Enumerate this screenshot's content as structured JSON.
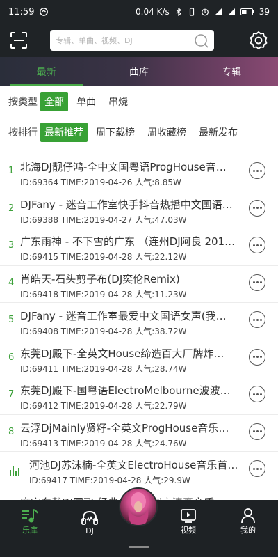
{
  "status_bar": {
    "time": "11:59",
    "speed": "0.04 K/s",
    "battery": "39"
  },
  "header": {
    "search_placeholder": "专辑、单曲、视频、DJ",
    "icons": [
      "scan-icon",
      "search-icon",
      "settings-icon"
    ]
  },
  "tabs": [
    "最新",
    "曲库",
    "专辑"
  ],
  "filters": {
    "type_label": "按类型",
    "type_options": [
      "全部",
      "单曲",
      "串烧"
    ],
    "sort_label": "按排行",
    "sort_options": [
      "最新推荐",
      "周下载榜",
      "周收藏榜",
      "最新发布"
    ]
  },
  "songs": [
    {
      "index": "1",
      "title": "北海DJ靓仔鸿-全中文国粤语ProgHouse音…",
      "meta": "ID:69364  TIME:2019-04-26  人气:8.85W"
    },
    {
      "index": "2",
      "title": "DJFany - 迷音工作室快手抖音热播中文国语…",
      "meta": "ID:69388  TIME:2019-04-27  人气:47.03W"
    },
    {
      "index": "3",
      "title": "广东雨神 - 不下雪的广东 （连州DJ阿良 201…",
      "meta": "ID:69415  TIME:2019-04-28  人气:22.12W"
    },
    {
      "index": "4",
      "title": "肖皓天-石头剪子布(DJ奕伦Remix)",
      "meta": "ID:69418  TIME:2019-04-28  人气:11.23W"
    },
    {
      "index": "5",
      "title": "DJFany - 迷音工作室最爱中文国语女声(我…",
      "meta": "ID:69408  TIME:2019-04-28  人气:38.72W"
    },
    {
      "index": "6",
      "title": "东莞DJ殿下-全英文House缔造百大厂牌炸…",
      "meta": "ID:69411  TIME:2019-04-28  人气:28.74W"
    },
    {
      "index": "7",
      "title": "东莞DJ殿下-国粤语ElectroMelbourne波波…",
      "meta": "ID:69412  TIME:2019-04-28  人气:22.79W"
    },
    {
      "index": "8",
      "title": "云浮DjMainly贤籽-全英文ProgHouse音乐缥…",
      "meta": "ID:69413  TIME:2019-04-28  人气:24.76W"
    },
    {
      "index": "",
      "title": "河池DJ苏沫楠-全英文ElectroHouse音乐首…",
      "meta": "ID:69417  TIME:2019-04-28  人气:29.9W",
      "playing": true
    },
    {
      "index": "",
      "title": "麻宣东载DJ国飞-经典……Hi-Fi高清真音质…",
      "meta": ""
    }
  ],
  "bottom_nav": [
    {
      "label": "乐库",
      "icon": "music-note-icon"
    },
    {
      "label": "DJ",
      "icon": "headphones-icon"
    },
    {
      "label": "视频",
      "icon": "video-icon"
    },
    {
      "label": "我的",
      "icon": "person-icon"
    }
  ],
  "colors": {
    "accent": "#38a135",
    "dark_bg": "#1f2326"
  }
}
